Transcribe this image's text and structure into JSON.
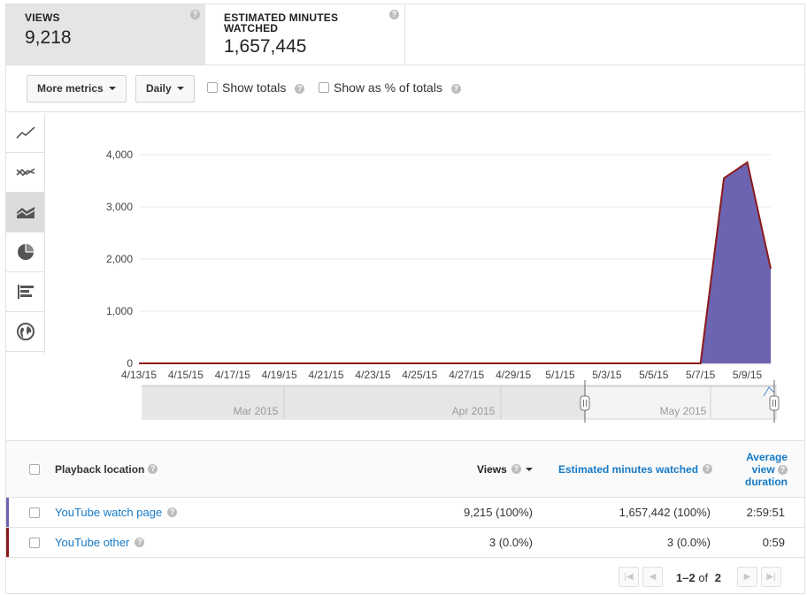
{
  "metrics": [
    {
      "label": "VIEWS",
      "value": "9,218",
      "active": true
    },
    {
      "label": "ESTIMATED MINUTES WATCHED",
      "value": "1,657,445",
      "active": false
    }
  ],
  "toolbar": {
    "more_metrics": "More metrics",
    "granularity": "Daily",
    "show_totals": "Show totals",
    "show_percent": "Show as % of totals"
  },
  "chart_types": [
    "line-chart-icon",
    "multi-line-chart-icon",
    "stacked-area-chart-icon",
    "pie-chart-icon",
    "bar-chart-icon",
    "globe-map-icon"
  ],
  "chart_data": {
    "type": "area",
    "x": [
      "4/13/15",
      "4/14/15",
      "4/15/15",
      "4/16/15",
      "4/17/15",
      "4/18/15",
      "4/19/15",
      "4/20/15",
      "4/21/15",
      "4/22/15",
      "4/23/15",
      "4/24/15",
      "4/25/15",
      "4/26/15",
      "4/27/15",
      "4/28/15",
      "4/29/15",
      "4/30/15",
      "5/1/15",
      "5/2/15",
      "5/3/15",
      "5/4/15",
      "5/5/15",
      "5/6/15",
      "5/7/15",
      "5/8/15",
      "5/9/15",
      "5/10/15"
    ],
    "x_tick_labels": [
      "4/13/15",
      "4/15/15",
      "4/17/15",
      "4/19/15",
      "4/21/15",
      "4/23/15",
      "4/25/15",
      "4/27/15",
      "4/29/15",
      "5/1/15",
      "5/3/15",
      "5/5/15",
      "5/7/15",
      "5/9/15"
    ],
    "series": [
      {
        "name": "YouTube other",
        "color": "#8b1a1a",
        "values": [
          0,
          0,
          0,
          0,
          0,
          0,
          0,
          0,
          0,
          0,
          0,
          0,
          0,
          0,
          0,
          0,
          0,
          0,
          0,
          0,
          0,
          0,
          0,
          0,
          0,
          0,
          3,
          0
        ]
      },
      {
        "name": "YouTube watch page",
        "color": "#6c64b0",
        "values": [
          0,
          0,
          0,
          0,
          0,
          0,
          0,
          0,
          0,
          0,
          0,
          0,
          0,
          0,
          0,
          0,
          0,
          0,
          0,
          0,
          0,
          0,
          0,
          0,
          0,
          3550,
          3850,
          1815
        ]
      }
    ],
    "ylim": [
      0,
      4000
    ],
    "y_ticks": [
      "0",
      "1,000",
      "2,000",
      "3,000",
      "4,000"
    ],
    "grid": true,
    "navigator_labels": [
      "Mar 2015",
      "Apr 2015",
      "May 2015"
    ]
  },
  "table": {
    "headers": {
      "location": "Playback location",
      "views": "Views",
      "minutes": "Estimated minutes watched",
      "avg_duration_1": "Average",
      "avg_duration_2": "view",
      "avg_duration_3": "duration"
    },
    "rows": [
      {
        "label": "YouTube watch page",
        "views": "9,215 (100%)",
        "minutes": "1,657,442 (100%)",
        "duration": "2:59:51",
        "color": "#6c64b0"
      },
      {
        "label": "YouTube other",
        "views": "3 (0.0%)",
        "minutes": "3 (0.0%)",
        "duration": "0:59",
        "color": "#8b1a1a"
      }
    ]
  },
  "pager": {
    "range": "1–2",
    "of": "of",
    "total": "2"
  }
}
